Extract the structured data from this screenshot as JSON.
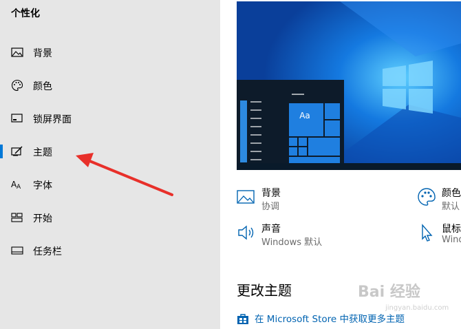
{
  "sidebar": {
    "title": "个性化",
    "items": [
      {
        "label": "背景",
        "icon": "image-icon"
      },
      {
        "label": "颜色",
        "icon": "palette-icon"
      },
      {
        "label": "锁屏界面",
        "icon": "lock-screen-icon"
      },
      {
        "label": "主题",
        "icon": "theme-brush-icon",
        "selected": true
      },
      {
        "label": "字体",
        "icon": "font-icon"
      },
      {
        "label": "开始",
        "icon": "start-icon"
      },
      {
        "label": "任务栏",
        "icon": "taskbar-icon"
      }
    ]
  },
  "preview": {
    "tile_text": "Aa"
  },
  "theme_settings": [
    {
      "title": "背景",
      "subtitle": "协调",
      "icon": "image-icon"
    },
    {
      "title": "颜色",
      "subtitle": "默认",
      "icon": "palette-icon"
    },
    {
      "title": "声音",
      "subtitle": "Windows 默认",
      "icon": "speaker-icon"
    },
    {
      "title": "鼠标",
      "subtitle": "Windows",
      "icon": "mouse-pointer-icon"
    }
  ],
  "section": {
    "title": "更改主题",
    "store_link": "在 Microsoft Store 中获取更多主题"
  },
  "watermark": {
    "text": "Bai 经验",
    "sub": "jingyan.baidu.com"
  },
  "colors": {
    "accent": "#0078d7",
    "link": "#0063b1",
    "annotation_arrow": "#e8302a"
  }
}
